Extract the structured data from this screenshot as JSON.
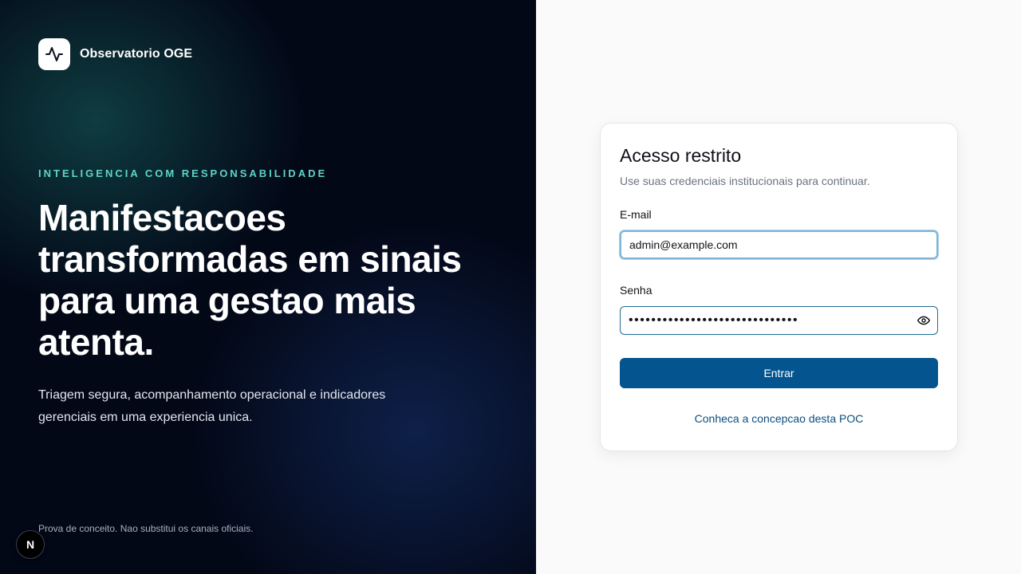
{
  "brand": {
    "name": "Observatorio OGE",
    "logo_icon": "activity-pulse-icon"
  },
  "hero": {
    "eyebrow": "INTELIGENCIA COM RESPONSABILIDADE",
    "headline": "Manifestacoes transformadas em sinais para uma gestao mais atenta.",
    "subtitle": "Triagem segura, acompanhamento operacional e indicadores gerenciais em uma experiencia unica.",
    "disclaimer": "Prova de conceito. Nao substitui os canais oficiais."
  },
  "login": {
    "title": "Acesso restrito",
    "description": "Use suas credenciais institucionais para continuar.",
    "email_label": "E-mail",
    "email_value": "admin@example.com",
    "password_label": "Senha",
    "password_value": "••••••••••••••••••••••••••••••",
    "password_toggle_icon": "eye-icon",
    "submit_label": "Entrar",
    "concept_link": "Conheca a concepcao desta POC"
  },
  "next_badge": {
    "letter": "N"
  },
  "colors": {
    "hero_background": "#030817",
    "accent_teal": "#5fd4c6",
    "primary_button": "#04558f",
    "link": "#0b4f7e"
  }
}
